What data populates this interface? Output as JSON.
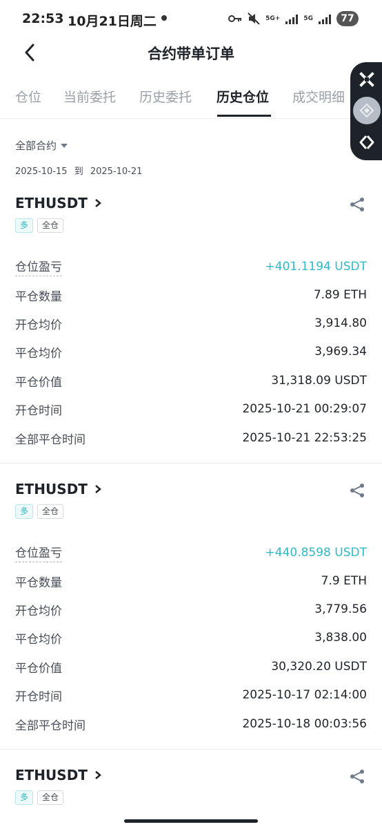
{
  "status_bar": {
    "time": "22:53",
    "date": "10月21日周二",
    "net1": "5G+",
    "net2": "5G",
    "battery": "77",
    "icons": [
      "key-icon",
      "mute-icon",
      "signal-icon",
      "signal-icon",
      "battery-icon"
    ]
  },
  "header": {
    "title": "合约带单订单",
    "back_icon": "chevron-left-icon"
  },
  "tabs": [
    "仓位",
    "当前委托",
    "历史委托",
    "历史仓位",
    "成交明细"
  ],
  "active_tab": "历史仓位",
  "floating_buttons": [
    "close-x-icon",
    "diamond-logo-icon",
    "swap-arrow-icon"
  ],
  "filter": {
    "label": "全部合约",
    "date_start": "2025-10-15",
    "date_sep": "到",
    "date_end": "2025-10-21"
  },
  "colors": {
    "accent_teal": "#2ebac6",
    "text_primary": "#1e2329",
    "text_secondary": "#474d57",
    "tab_inactive": "#9aa0a8"
  },
  "positions": [
    {
      "symbol": "ETHUSDT",
      "side_tag": "多",
      "margin_tag": "全仓",
      "rows": [
        {
          "label": "仓位盈亏",
          "value": "+401.1194 USDT"
        },
        {
          "label": "平仓数量",
          "value": "7.89 ETH"
        },
        {
          "label": "开仓均价",
          "value": "3,914.80"
        },
        {
          "label": "平仓均价",
          "value": "3,969.34"
        },
        {
          "label": "平仓价值",
          "value": "31,318.09 USDT"
        },
        {
          "label": "开仓时间",
          "value": "2025-10-21 00:29:07"
        },
        {
          "label": "全部平仓时间",
          "value": "2025-10-21 22:53:25"
        }
      ]
    },
    {
      "symbol": "ETHUSDT",
      "side_tag": "多",
      "margin_tag": "全仓",
      "rows": [
        {
          "label": "仓位盈亏",
          "value": "+440.8598 USDT"
        },
        {
          "label": "平仓数量",
          "value": "7.9 ETH"
        },
        {
          "label": "开仓均价",
          "value": "3,779.56"
        },
        {
          "label": "平仓均价",
          "value": "3,838.00"
        },
        {
          "label": "平仓价值",
          "value": "30,320.20 USDT"
        },
        {
          "label": "开仓时间",
          "value": "2025-10-17 02:14:00"
        },
        {
          "label": "全部平仓时间",
          "value": "2025-10-18 00:03:56"
        }
      ]
    },
    {
      "symbol": "ETHUSDT",
      "side_tag": "多",
      "margin_tag": "全仓"
    }
  ]
}
